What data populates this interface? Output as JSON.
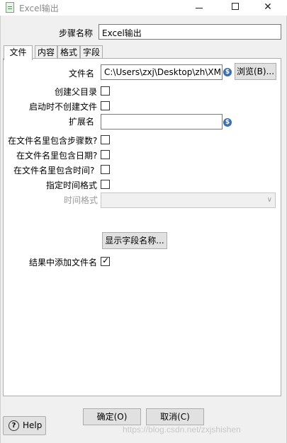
{
  "window": {
    "title": "Excel输出"
  },
  "step_name": {
    "label": "步骤名称",
    "value": "Excel输出"
  },
  "tabs": [
    {
      "label": "文件"
    },
    {
      "label": "内容"
    },
    {
      "label": "格式"
    },
    {
      "label": "字段"
    }
  ],
  "file_tab": {
    "filename_label": "文件名",
    "filename_value": "C:\\Users\\zxj\\Desktop\\zh\\XM",
    "browse_label": "浏览(B)...",
    "create_parent_label": "创建父目录",
    "no_create_on_start_label": "启动时不创建文件",
    "extension_label": "扩展名",
    "extension_value": "",
    "include_stepnr_label": "在文件名里包含步骤数?",
    "include_date_label": "在文件名里包含日期?",
    "include_time_label": "在文件名里包含时间?",
    "specify_format_label": "指定时间格式",
    "date_format_label": "时间格式",
    "date_format_value": "",
    "show_fields_label": "显示字段名称...",
    "add_to_result_label": "结果中添加文件名",
    "checkboxes": {
      "create_parent": false,
      "no_create_on_start": false,
      "include_stepnr": false,
      "include_date": false,
      "include_time": false,
      "specify_format": false,
      "add_to_result": true
    }
  },
  "footer": {
    "ok_label": "确定(O)",
    "cancel_label": "取消(C)",
    "help_label": "Help",
    "watermark": "https://blog.csdn.net/zxjshishen"
  },
  "icons": {
    "variable": "dollar-variable-icon",
    "help": "question-circle-icon",
    "app": "spoon-document-icon"
  }
}
